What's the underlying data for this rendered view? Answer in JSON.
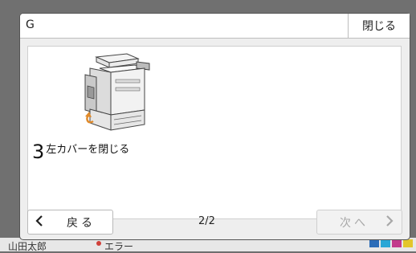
{
  "background": {
    "footer_user": "山田太郎",
    "footer_item": "エラー"
  },
  "dialog": {
    "title": "G",
    "close_label": "閉じる"
  },
  "content": {
    "step_number": "3",
    "step_text": "左カバーを閉じる",
    "illustration_icon": "printer-left-cover-close-illustration"
  },
  "navigation": {
    "back_label": "戻る",
    "page_indicator": "2/2",
    "next_label": "次へ",
    "next_enabled": false
  },
  "colors": {
    "next_disabled_text": "#a8a8a8",
    "accent_arrow": "#e08a2a"
  }
}
